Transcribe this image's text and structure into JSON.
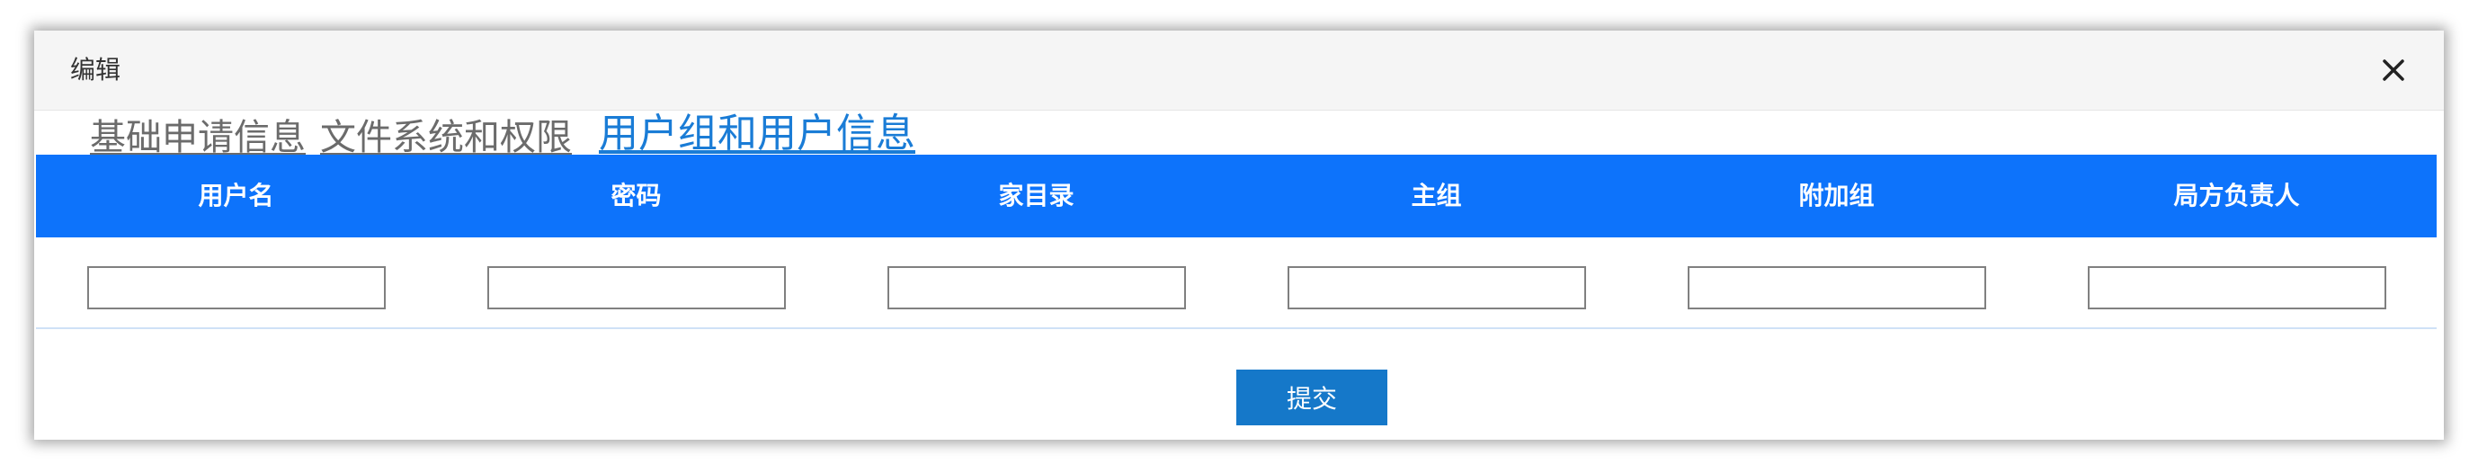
{
  "dialog": {
    "title": "编辑",
    "close_icon": "close-icon"
  },
  "tabs": [
    {
      "label": "基础申请信息",
      "active": false
    },
    {
      "label": "文件系统和权限",
      "active": false
    },
    {
      "label": "用户组和用户信息",
      "active": true
    }
  ],
  "table": {
    "columns": [
      "用户名",
      "密码",
      "家目录",
      "主组",
      "附加组",
      "局方负责人"
    ],
    "rows": [
      {
        "values": [
          "",
          "",
          "",
          "",
          "",
          ""
        ]
      }
    ]
  },
  "actions": {
    "submit_label": "提交"
  },
  "colors": {
    "header_bar": "#0d73fb",
    "active_tab": "#1a7cd6",
    "submit": "#1578c9"
  }
}
